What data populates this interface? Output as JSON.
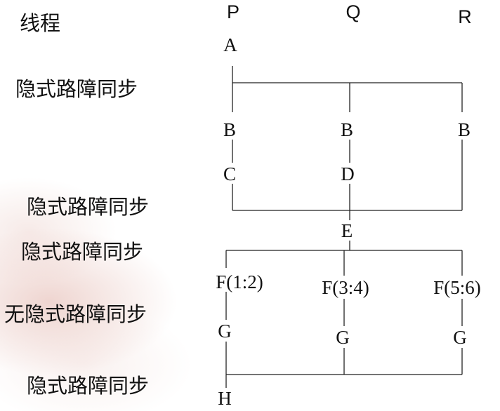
{
  "header": {
    "row_label": "线程",
    "threads": [
      "P",
      "Q",
      "R"
    ]
  },
  "row_labels": [
    "隐式路障同步",
    "隐式路障同步",
    "隐式路障同步",
    "无隐式路障同步",
    "隐式路障同步"
  ],
  "nodes": {
    "a": "A",
    "b_p": "B",
    "b_q": "B",
    "b_r": "B",
    "c": "C",
    "d": "D",
    "e": "E",
    "f_p": "F(1:2)",
    "f_q": "F(3:4)",
    "f_r": "F(5:6)",
    "g_p": "G",
    "g_q": "G",
    "g_r": "G",
    "h": "H"
  },
  "colors": {
    "text": "#111111",
    "line": "#222222",
    "background_accent": "#d6968a"
  }
}
